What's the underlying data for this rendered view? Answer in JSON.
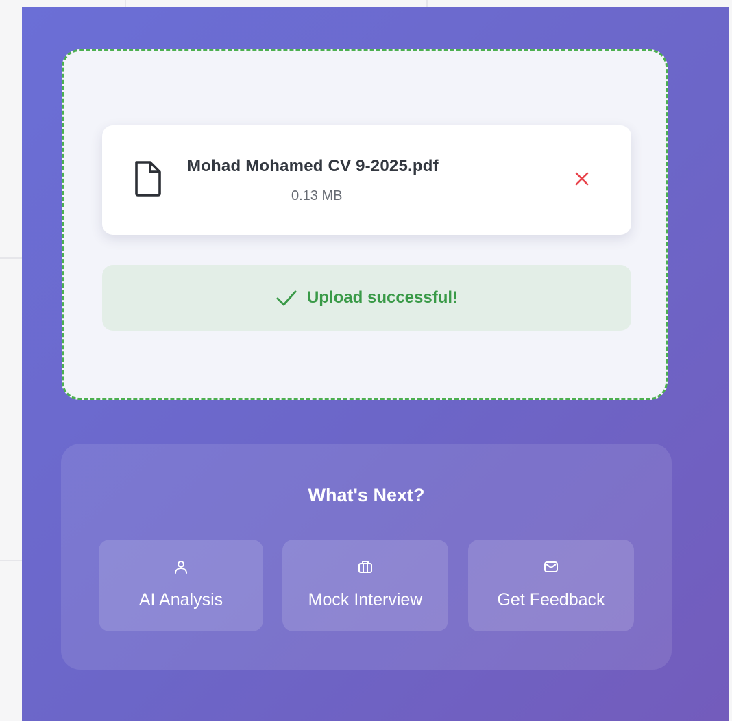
{
  "upload": {
    "file_name": "Mohad Mohamed CV 9-2025.pdf",
    "file_size": "0.13 MB",
    "file_icon": "file-icon",
    "remove_icon": "close-icon",
    "success_icon": "checkmark-icon",
    "success_message": "Upload successful!"
  },
  "next": {
    "title": "What's Next?",
    "options": [
      {
        "label": "AI Analysis",
        "icon": "user-icon"
      },
      {
        "label": "Mock Interview",
        "icon": "briefcase-icon"
      },
      {
        "label": "Get Feedback",
        "icon": "mail-icon"
      }
    ]
  },
  "colors": {
    "panel_gradient_start": "#6b6fd6",
    "panel_gradient_end": "#735cbc",
    "dropzone_border": "#4caf50",
    "success_text": "#3a9a48",
    "success_background": "#e3eee7",
    "remove_icon": "#e8434b"
  }
}
